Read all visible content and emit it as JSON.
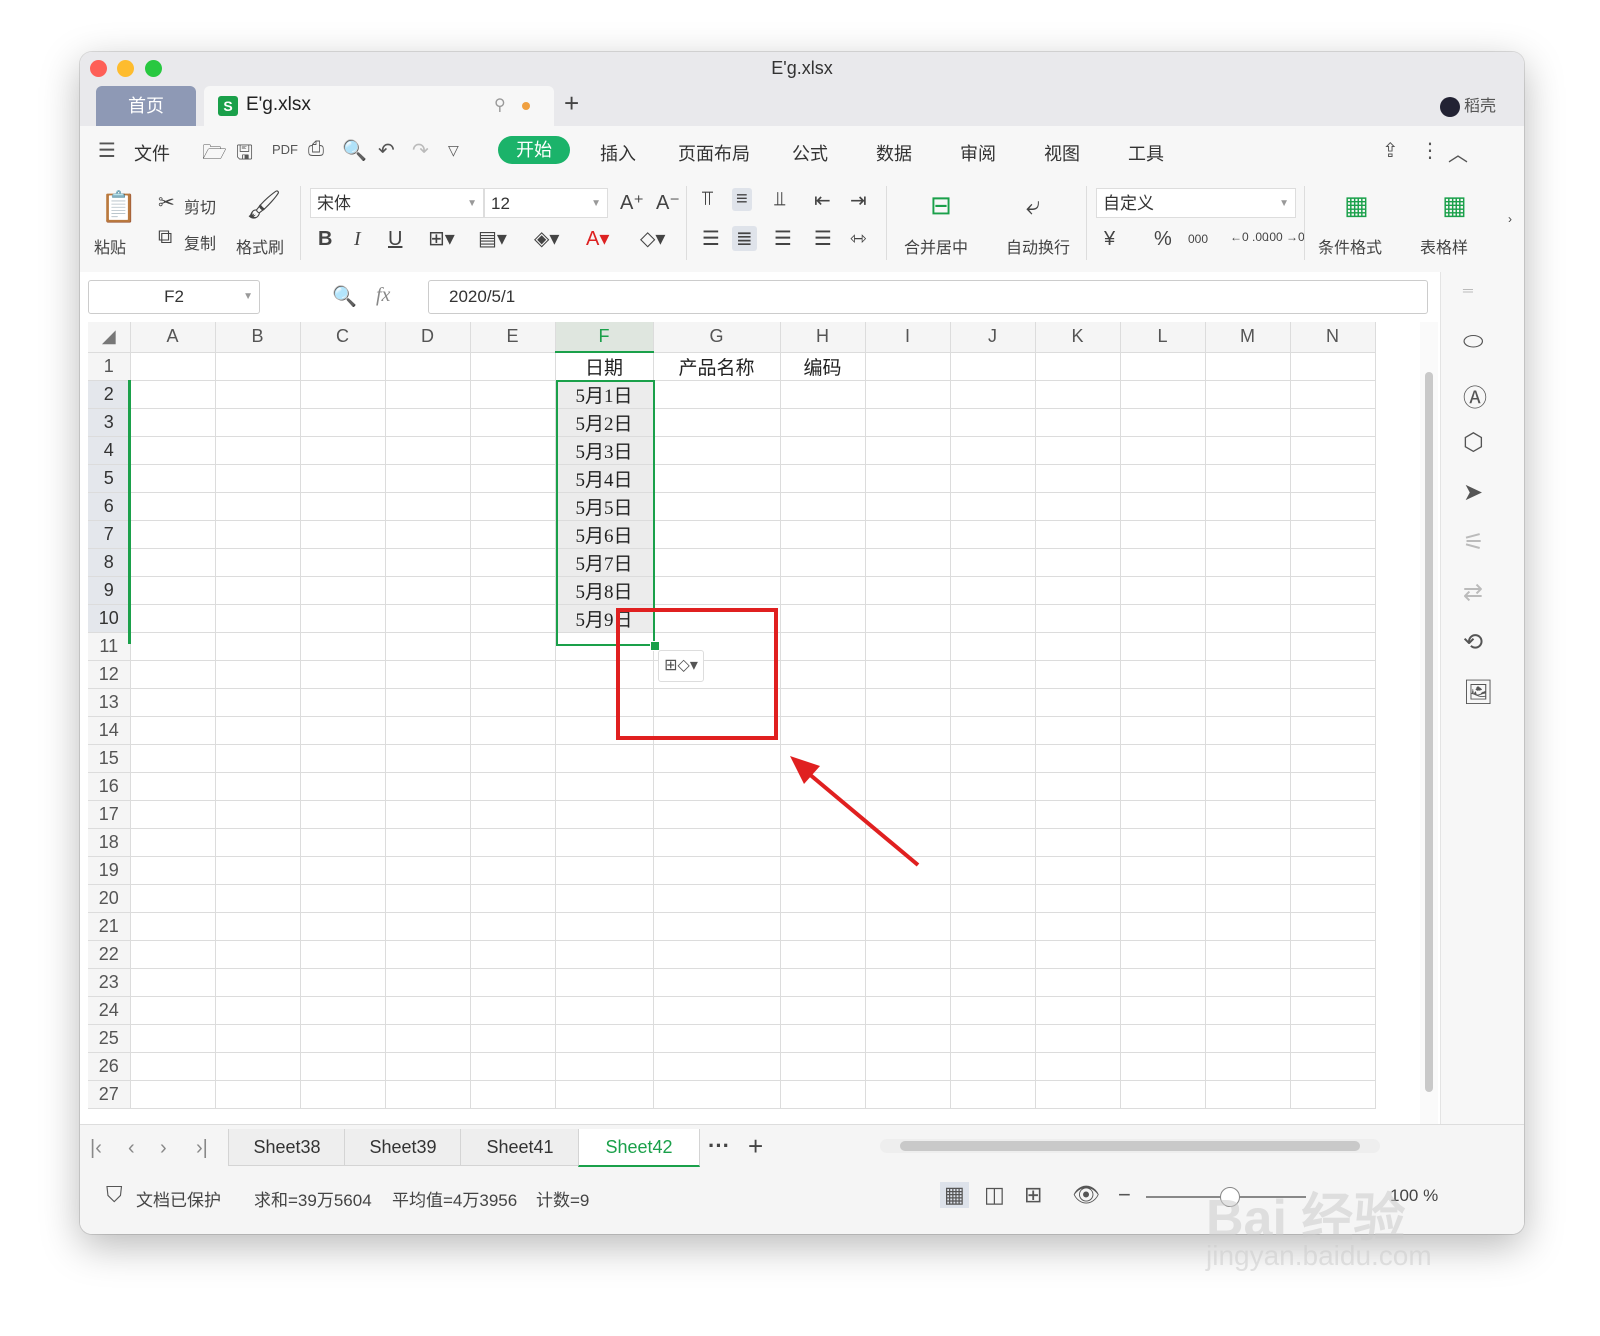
{
  "window": {
    "title": "E'g.xlsx"
  },
  "tabs": {
    "home": "首页",
    "file": "E'g.xlsx",
    "add": "+",
    "user": "稻壳"
  },
  "menu": {
    "file": "文件",
    "items": [
      "开始",
      "插入",
      "页面布局",
      "公式",
      "数据",
      "审阅",
      "视图",
      "工具"
    ]
  },
  "ribbon": {
    "paste": "粘贴",
    "cut": "剪切",
    "copy": "复制",
    "format_painter": "格式刷",
    "font_name": "宋体",
    "font_size": "12",
    "bold": "B",
    "italic": "I",
    "underline": "U",
    "merge_center": "合并居中",
    "wrap_text": "自动换行",
    "number_format": "自定义",
    "currency": "¥",
    "percent": "%",
    "thousands": "000",
    "inc_decimal": "←0 .00",
    "dec_decimal": ".00 →0",
    "conditional_format": "条件格式",
    "table_style": "表格样"
  },
  "formula_bar": {
    "name_box": "F2",
    "fx": "fx",
    "value": "2020/5/1"
  },
  "sheet": {
    "columns": [
      "A",
      "B",
      "C",
      "D",
      "E",
      "F",
      "G",
      "H",
      "I",
      "J",
      "K",
      "L",
      "M",
      "N"
    ],
    "rows": [
      "1",
      "2",
      "3",
      "4",
      "5",
      "6",
      "7",
      "8",
      "9",
      "10",
      "11",
      "12",
      "13",
      "14",
      "15",
      "16",
      "17",
      "18",
      "19",
      "20",
      "21",
      "22",
      "23",
      "24",
      "25",
      "26",
      "27"
    ],
    "headers": {
      "F1": "日期",
      "G1": "产品名称",
      "H1": "编码"
    },
    "f_values": [
      "5月1日",
      "5月2日",
      "5月3日",
      "5月4日",
      "5月5日",
      "5月6日",
      "5月7日",
      "5月8日",
      "5月9日"
    ]
  },
  "sheet_tabs": [
    "Sheet38",
    "Sheet39",
    "Sheet41",
    "Sheet42"
  ],
  "active_sheet": "Sheet42",
  "sheet_more": "···",
  "status": {
    "protected": "文档已保护",
    "sum": "求和=39万5604",
    "average": "平均值=4万3956",
    "count": "计数=9",
    "zoom": "100 %"
  },
  "watermark": {
    "brand": "Bai 经验",
    "url": "jingyan.baidu.com"
  },
  "colors": {
    "accent": "#1bb36a",
    "selection": "#1aa04a",
    "annotation": "#e02020"
  }
}
